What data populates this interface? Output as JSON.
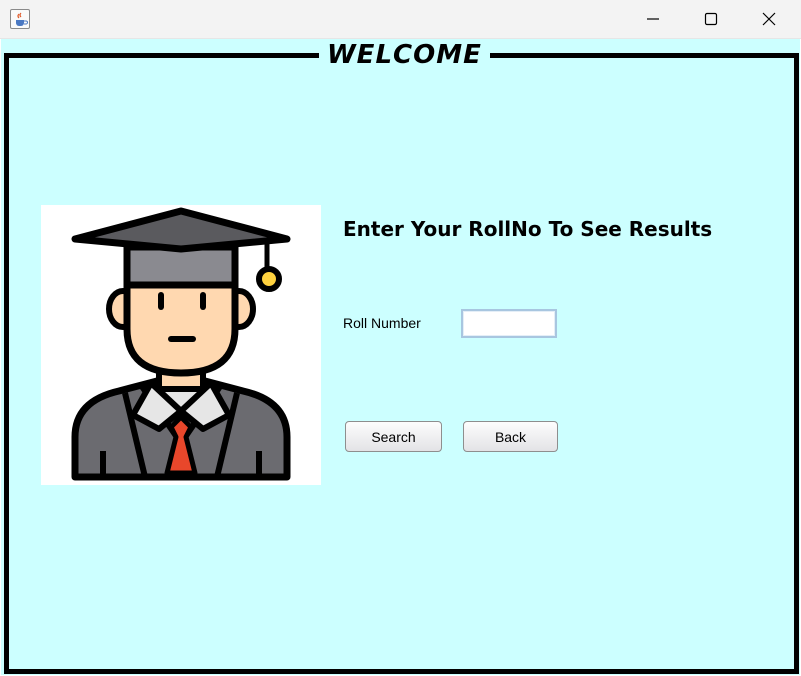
{
  "window": {
    "icon": "java-cup-icon",
    "controls": [
      "minimize-icon",
      "maximize-icon",
      "close-icon"
    ]
  },
  "panel": {
    "border_title": "WELCOME"
  },
  "form": {
    "heading": "Enter Your RollNo To See Results",
    "roll_label": "Roll Number",
    "roll_value": "",
    "search_label": "Search",
    "back_label": "Back"
  },
  "image": {
    "subject": "graduate-student-avatar"
  },
  "colors": {
    "background": "#ccffff",
    "border": "#000000",
    "tie": "#e8472b",
    "cap": "#5a5a5e"
  }
}
